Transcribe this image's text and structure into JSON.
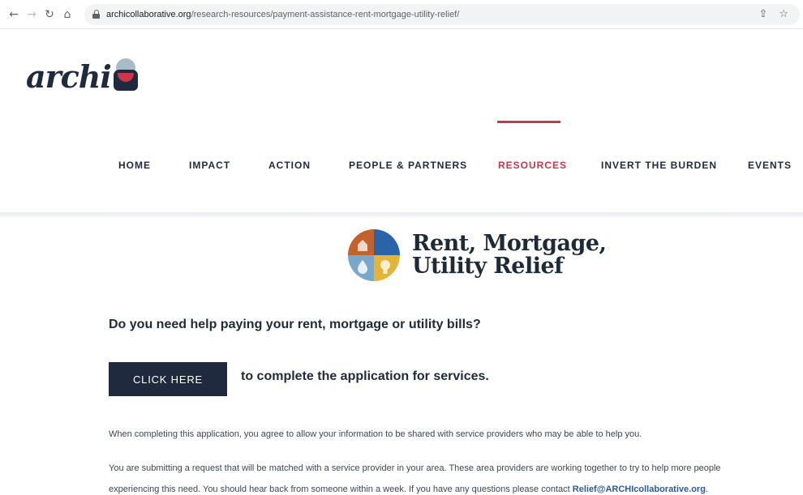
{
  "browser": {
    "url_domain": "archicollaborative.org",
    "url_path": "/research-resources/payment-assistance-rent-mortgage-utility-relief/",
    "icons": [
      "back-icon",
      "forward-icon",
      "reload-icon",
      "home-icon",
      "lock-icon",
      "share-icon",
      "bookmark-star-icon"
    ]
  },
  "header": {
    "logo_text": "archi",
    "nav": {
      "items": [
        {
          "label": "HOME"
        },
        {
          "label": "IMPACT"
        },
        {
          "label": "ACTION"
        },
        {
          "label": "PEOPLE & PARTNERS"
        },
        {
          "label": "RESOURCES",
          "active": true
        },
        {
          "label": "INVERT THE BURDEN"
        },
        {
          "label": "EVENTS"
        }
      ]
    },
    "colors": {
      "accent": "#c9374a",
      "navy": "#1f2a3f"
    }
  },
  "feature": {
    "title_line1": "Rent, Mortgage,",
    "title_line2": "Utility Relief",
    "quadrant_colors": [
      "#c4622d",
      "#2a63a8",
      "#7aa6c9",
      "#e3b437"
    ]
  },
  "content": {
    "question": "Do you need help paying your rent, mortgage or utility bills?",
    "cta_button": "CLICK HERE",
    "cta_text": "to complete the application for services.",
    "para1": "When completing this application, you agree to allow your information to be shared with service providers who may be able to help you.",
    "para2_line1": "You are submitting a request that will be matched with a service provider in your area. These area providers are working together to try to help more people",
    "para2_line2": "experiencing this need. You should hear back from someone within a week. If you have any questions please contact",
    "email": "Relief@ARCHIcollaborative.org",
    "period": "."
  }
}
